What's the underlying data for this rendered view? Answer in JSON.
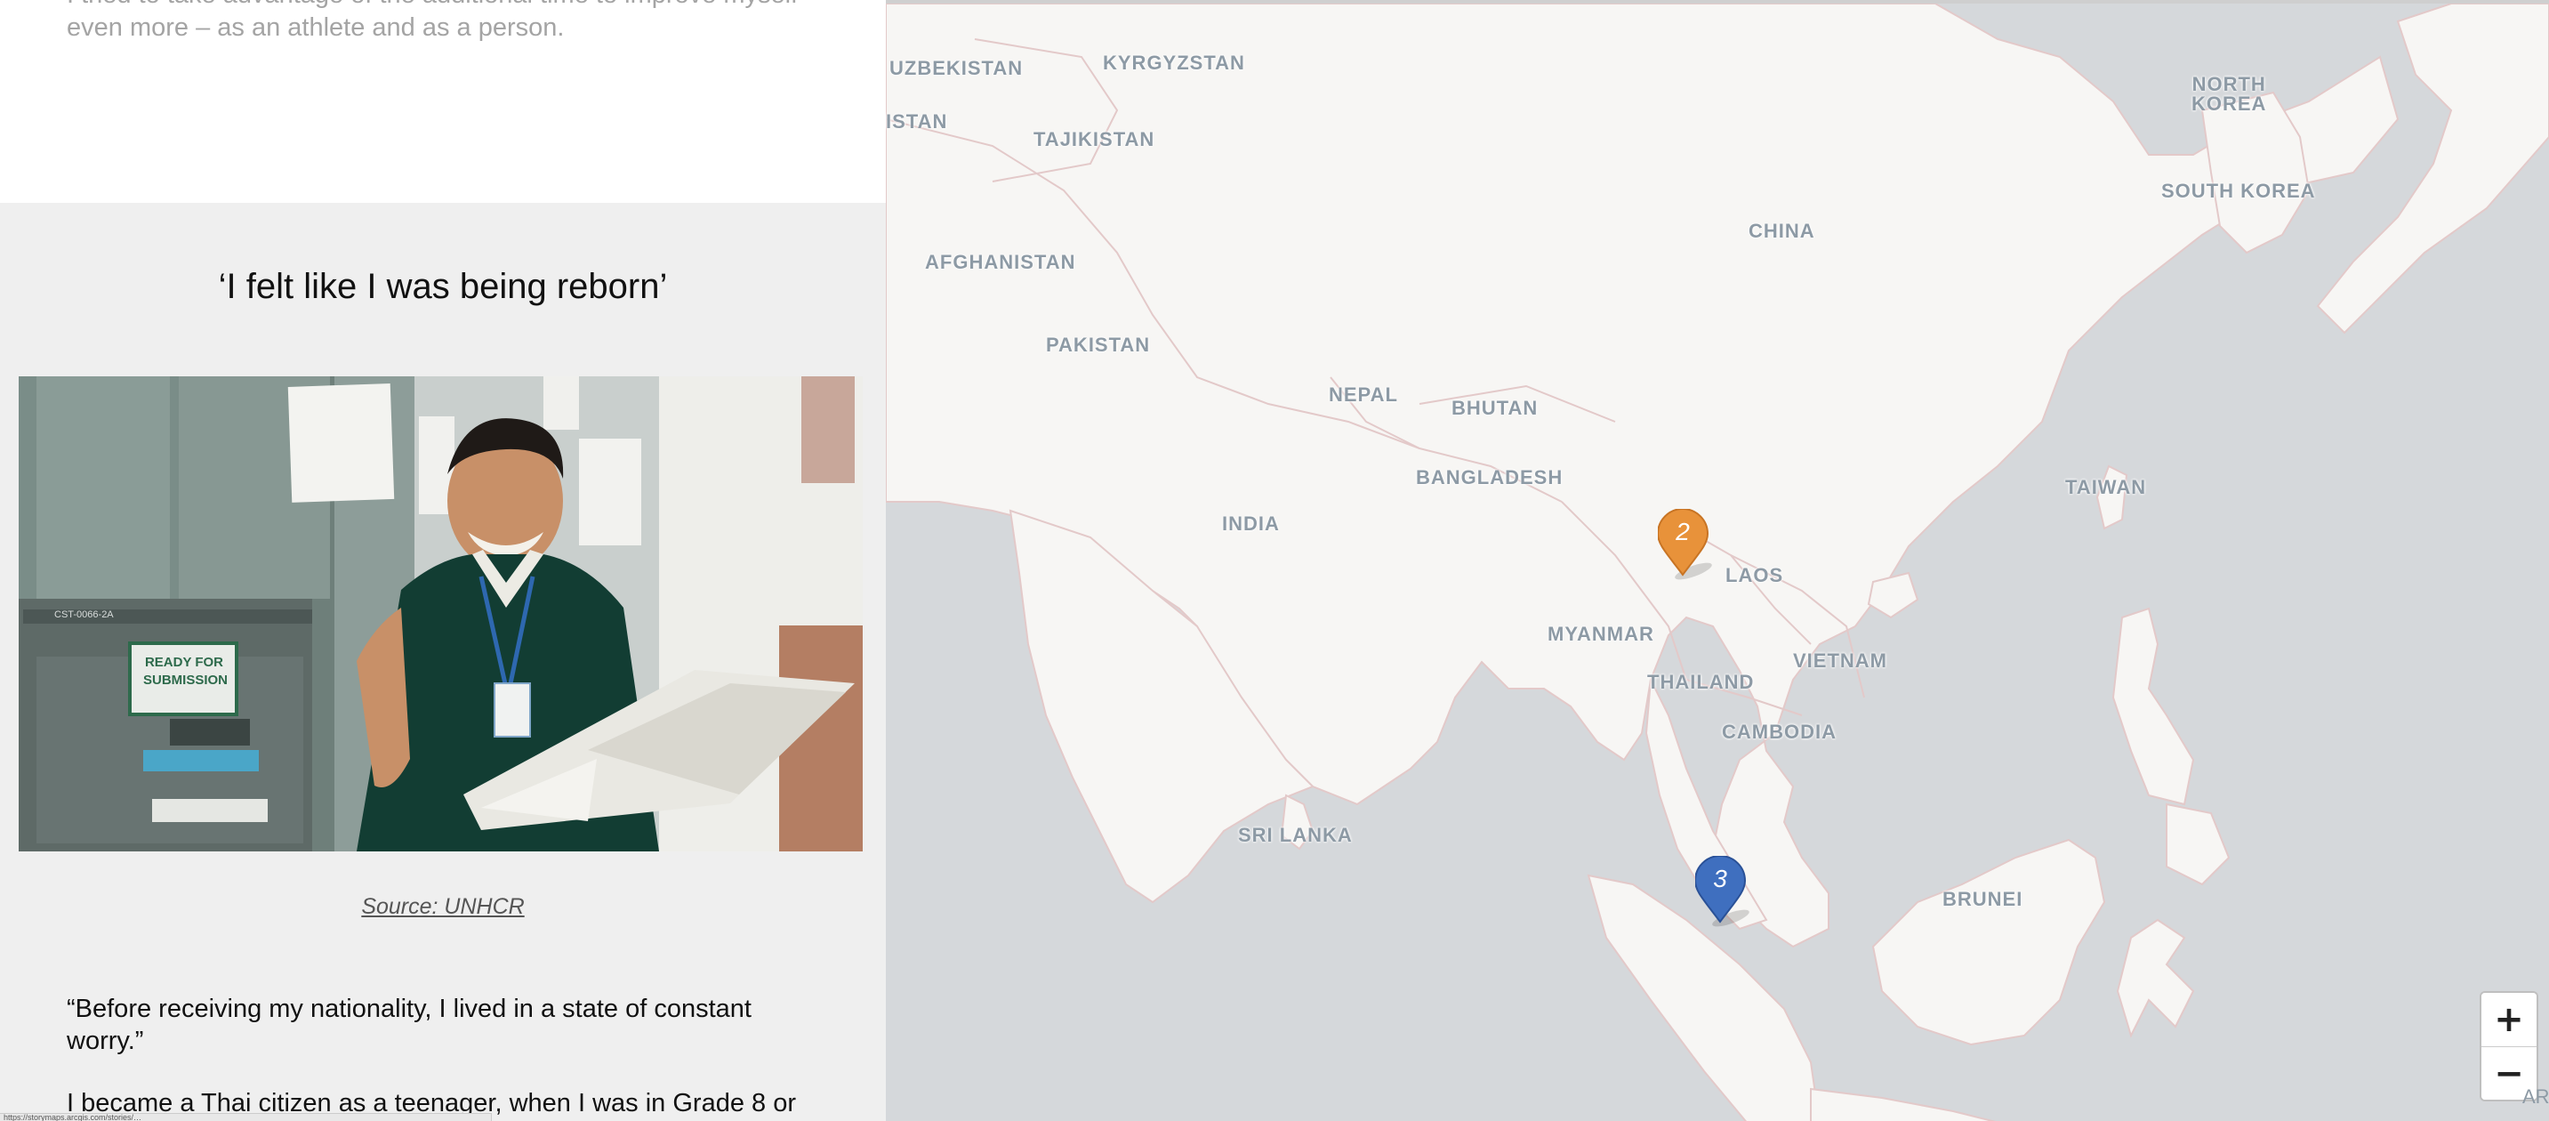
{
  "story": {
    "prev_paragraph": "I tried to take advantage of the additional time to improve myself even more – as an athlete and as a person.",
    "chapter_title": "‘I felt like I was being reborn’",
    "photo": {
      "sign_text": "READY FOR\nSUBMISSION",
      "drawer_label": "CST-0066-2A"
    },
    "photo_source": "Source: UNHCR",
    "paragraphs": [
      "“Before receiving my nationality, I lived in a state of constant worry.”",
      "I became a Thai citizen as a teenager, when I was in Grade 8 or"
    ],
    "status_url": "https://storymaps.arcgis.com/stories/…"
  },
  "map": {
    "colors": {
      "water": "#d5d8db",
      "land": "#f7f6f4",
      "border": "#e3c9c9",
      "label": "#8d9aa5",
      "marker_orange": "#e8923a",
      "marker_blue": "#3f6fbf"
    },
    "country_labels": [
      "UZBEKISTAN",
      "KYRGYZSTAN",
      "ISTAN",
      "TAJIKISTAN",
      "NORTH\nKOREA",
      "SOUTH KOREA",
      "CHINA",
      "AFGHANISTAN",
      "PAKISTAN",
      "NEPAL",
      "BHUTAN",
      "BANGLADESH",
      "INDIA",
      "TAIWAN",
      "LAOS",
      "MYANMAR",
      "VIETNAM",
      "THAILAND",
      "CAMBODIA",
      "SRI LANKA",
      "BRUNEI"
    ],
    "markers": [
      {
        "number": "2",
        "color": "orange"
      },
      {
        "number": "3",
        "color": "blue"
      }
    ],
    "zoom_in_label": "+",
    "zoom_out_label": "−",
    "attribution_stub": "AR"
  }
}
